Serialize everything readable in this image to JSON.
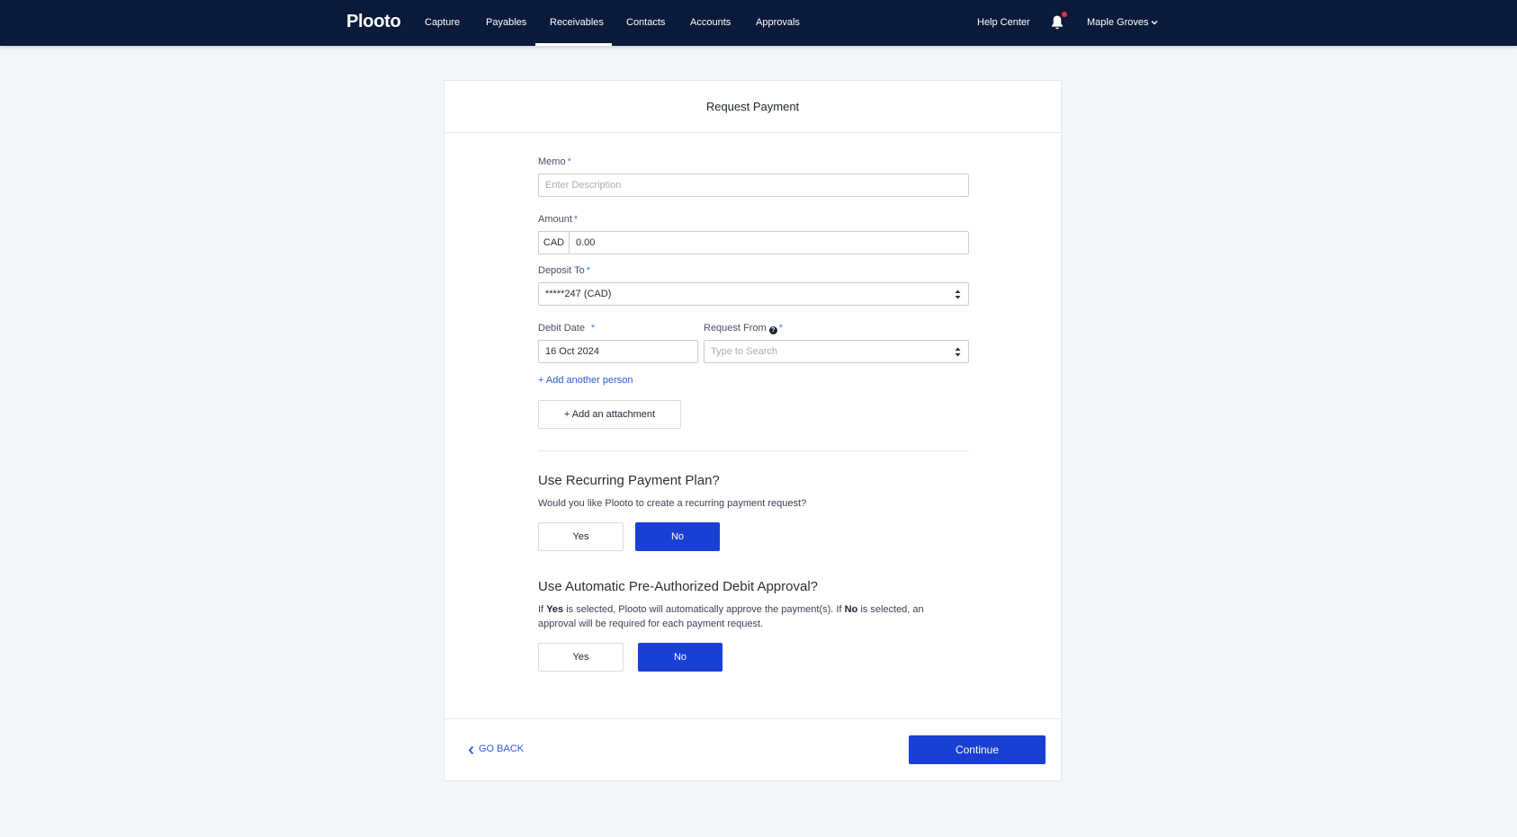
{
  "nav": {
    "logo": "Plooto",
    "items": [
      {
        "label": "Capture"
      },
      {
        "label": "Payables"
      },
      {
        "label": "Receivables"
      },
      {
        "label": "Contacts"
      },
      {
        "label": "Accounts"
      },
      {
        "label": "Approvals"
      }
    ],
    "active_item": "Receivables",
    "help_center": "Help Center",
    "user_name": "Maple Groves"
  },
  "card": {
    "title": "Request Payment",
    "memo": {
      "label": "Memo",
      "required": "*",
      "placeholder": "Enter Description",
      "value": ""
    },
    "amount": {
      "label": "Amount",
      "required": "*",
      "currency": "CAD",
      "value": "0.00"
    },
    "deposit_to": {
      "label": "Deposit To",
      "required": "*",
      "value": "*****247 (CAD)"
    },
    "debit_date": {
      "label": "Debit Date",
      "required": "*",
      "value": "16 Oct 2024"
    },
    "request_from": {
      "label": "Request From",
      "required": "*",
      "help_glyph": "?",
      "placeholder": "Type to Search"
    },
    "add_person": "+ Add another person",
    "add_attachment": "+ Add an attachment",
    "recurring": {
      "title": "Use Recurring Payment Plan?",
      "description": "Would you like Plooto to create a recurring payment request?",
      "yes": "Yes",
      "no": "No",
      "selected": "No"
    },
    "pad": {
      "title": "Use Automatic Pre-Authorized Debit Approval?",
      "desc_part1": "If",
      "desc_yes": "Yes",
      "desc_part2": "is selected, Plooto will automatically approve the payment(s). If",
      "desc_no": "No",
      "desc_part3": "is selected, an approval will be required for each payment request.",
      "yes": "Yes",
      "no": "No",
      "selected": "No"
    },
    "footer": {
      "go_back": "GO BACK",
      "continue": "Continue"
    }
  },
  "colors": {
    "nav_bg": "#0b1a3a",
    "primary_blue": "#1a3fd4",
    "link_blue": "#2c5bd8",
    "notification_dot": "#e0333a",
    "page_bg": "#f3f6f9"
  },
  "icons": [
    "bell-icon",
    "chevron-down-icon",
    "help-icon",
    "sort-arrows-icon",
    "chevron-left-icon"
  ]
}
